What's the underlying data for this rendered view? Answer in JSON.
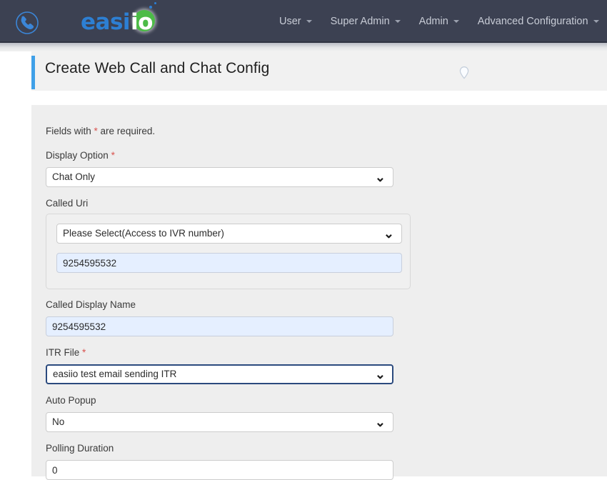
{
  "nav": {
    "brand": {
      "phone_icon": "phone-call-icon",
      "logo_primary": "easi",
      "logo_accent": "io"
    },
    "items": [
      {
        "label": "User",
        "caret": "chevron-down-icon"
      },
      {
        "label": "Super Admin",
        "caret": "chevron-down-icon"
      },
      {
        "label": "Admin",
        "caret": "chevron-down-icon"
      },
      {
        "label": "Advanced Configuration",
        "caret": "chevron-down-icon"
      }
    ]
  },
  "page": {
    "title": "Create Web Call and Chat Config",
    "pin_icon": "map-pin-icon",
    "accent_color": "#3fa0e8"
  },
  "form": {
    "required_note_before": "Fields with ",
    "required_note_star": "*",
    "required_note_after": " are required.",
    "fields": {
      "display_option": {
        "label": "Display Option",
        "required_marker": "*",
        "value": "Chat Only",
        "chevron": "chevron-down-icon"
      },
      "called_uri": {
        "label": "Called Uri",
        "select_value": "Please Select(Access to IVR number)",
        "chevron": "chevron-down-icon",
        "number_value": "9254595532"
      },
      "called_display_name": {
        "label": "Called Display Name",
        "value": "9254595532"
      },
      "itr_file": {
        "label": "ITR File",
        "required_marker": "*",
        "value": "easiio test email sending ITR",
        "chevron": "chevron-down-icon"
      },
      "auto_popup": {
        "label": "Auto Popup",
        "value": "No",
        "chevron": "chevron-down-icon"
      },
      "polling_duration": {
        "label": "Polling Duration",
        "value": "0"
      }
    }
  }
}
